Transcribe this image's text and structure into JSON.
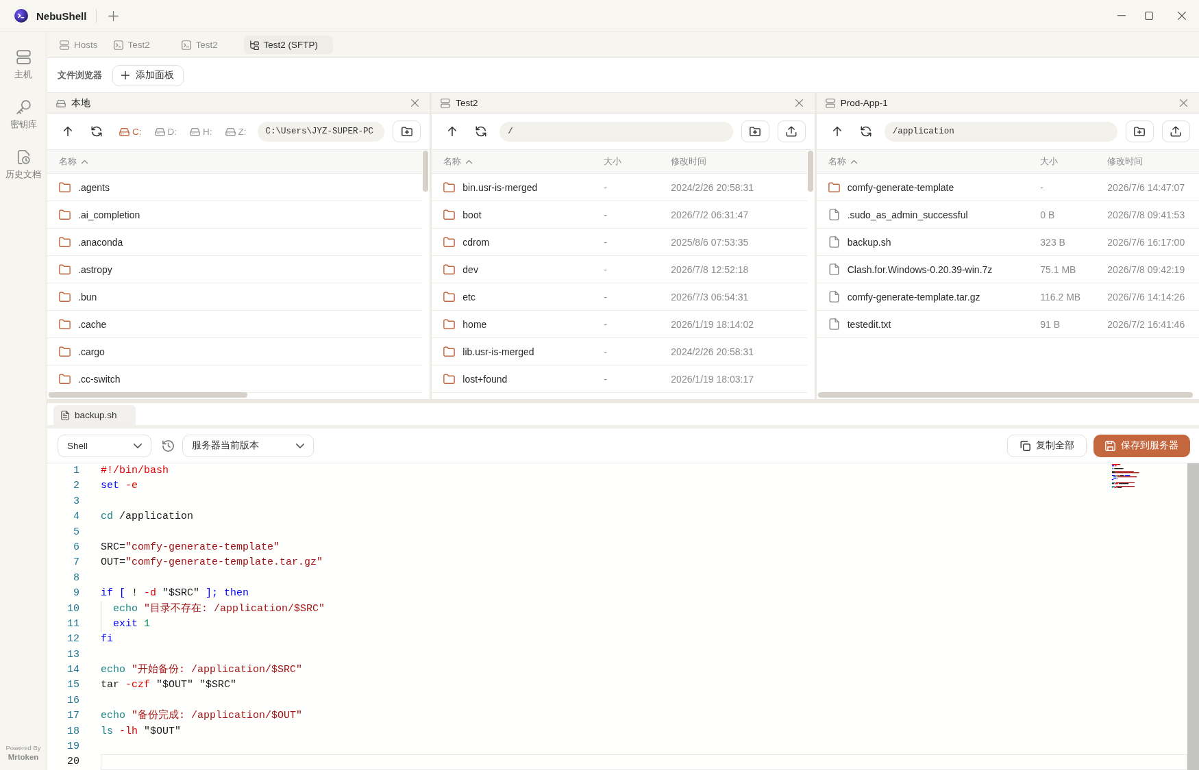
{
  "window": {
    "app_name": "NebuShell"
  },
  "sidebar": {
    "items": [
      {
        "label": "主机",
        "kind": "hosts"
      },
      {
        "label": "密钥库",
        "kind": "keys"
      },
      {
        "label": "历史文档",
        "kind": "history"
      }
    ],
    "footer": {
      "caption": "Powered By",
      "brand": "Mrtoken"
    }
  },
  "tabs": [
    {
      "label": "Hosts",
      "kind": "hosts",
      "selected": false
    },
    {
      "label": "Test2",
      "kind": "terminal",
      "selected": false
    },
    {
      "label": "Test2",
      "kind": "terminal",
      "selected": false
    },
    {
      "label": "Test2 (SFTP)",
      "kind": "sftp",
      "selected": true
    }
  ],
  "toolbar": {
    "title": "文件浏览器",
    "add_button": "添加面板"
  },
  "panels": [
    {
      "kind": "local",
      "title": "本地",
      "drives": [
        {
          "label": "C:",
          "selected": true
        },
        {
          "label": "D:",
          "selected": false
        },
        {
          "label": "H:",
          "selected": false
        },
        {
          "label": "Z:",
          "selected": false
        }
      ],
      "path": "C:\\Users\\JYZ-SUPER-PC",
      "columns": [
        {
          "kind": "name",
          "label": "名称",
          "sorted": true
        }
      ],
      "rows": [
        {
          "kind": "folder",
          "name": ".agents"
        },
        {
          "kind": "folder",
          "name": ".ai_completion"
        },
        {
          "kind": "folder",
          "name": ".anaconda"
        },
        {
          "kind": "folder",
          "name": ".astropy"
        },
        {
          "kind": "folder",
          "name": ".bun"
        },
        {
          "kind": "folder",
          "name": ".cache"
        },
        {
          "kind": "folder",
          "name": ".cargo"
        },
        {
          "kind": "folder",
          "name": ".cc-switch"
        }
      ],
      "scroll_x": true,
      "scroll_y": true
    },
    {
      "kind": "remote",
      "title": "Test2",
      "path": "/",
      "columns": [
        {
          "kind": "name",
          "label": "名称",
          "sorted": true
        },
        {
          "kind": "size",
          "label": "大小",
          "sorted": false
        },
        {
          "kind": "modified",
          "label": "修改时间",
          "sorted": false
        }
      ],
      "rows": [
        {
          "kind": "folder",
          "name": "bin.usr-is-merged",
          "size": "-",
          "modified": "2024/2/26 20:58:31"
        },
        {
          "kind": "folder",
          "name": "boot",
          "size": "-",
          "modified": "2026/7/2 06:31:47"
        },
        {
          "kind": "folder",
          "name": "cdrom",
          "size": "-",
          "modified": "2025/8/6 07:53:35"
        },
        {
          "kind": "folder",
          "name": "dev",
          "size": "-",
          "modified": "2026/7/8 12:52:18"
        },
        {
          "kind": "folder",
          "name": "etc",
          "size": "-",
          "modified": "2026/7/3 06:54:31"
        },
        {
          "kind": "folder",
          "name": "home",
          "size": "-",
          "modified": "2026/1/19 18:14:02"
        },
        {
          "kind": "folder",
          "name": "lib.usr-is-merged",
          "size": "-",
          "modified": "2024/2/26 20:58:31"
        },
        {
          "kind": "folder",
          "name": "lost+found",
          "size": "-",
          "modified": "2026/1/19 18:03:17"
        }
      ],
      "scroll_x": false,
      "scroll_y": true
    },
    {
      "kind": "remote",
      "title": "Prod-App-1",
      "path": "/application",
      "columns": [
        {
          "kind": "name",
          "label": "名称",
          "sorted": true
        },
        {
          "kind": "size",
          "label": "大小",
          "sorted": false
        },
        {
          "kind": "modified",
          "label": "修改时间",
          "sorted": false
        }
      ],
      "rows": [
        {
          "kind": "folder",
          "name": "comfy-generate-template",
          "size": "-",
          "modified": "2026/7/6 14:47:07"
        },
        {
          "kind": "file",
          "name": ".sudo_as_admin_successful",
          "size": "0 B",
          "modified": "2026/7/8 09:41:53"
        },
        {
          "kind": "file",
          "name": "backup.sh",
          "size": "323 B",
          "modified": "2026/7/6 16:17:00"
        },
        {
          "kind": "file",
          "name": "Clash.for.Windows-0.20.39-win.7z",
          "size": "75.1 MB",
          "modified": "2026/7/8 09:42:19"
        },
        {
          "kind": "file",
          "name": "comfy-generate-template.tar.gz",
          "size": "116.2 MB",
          "modified": "2026/7/6 14:14:26"
        },
        {
          "kind": "file",
          "name": "testedit.txt",
          "size": "91 B",
          "modified": "2026/7/2 16:41:46"
        }
      ],
      "scroll_x": true,
      "scroll_y": false
    }
  ],
  "editor": {
    "tabs": [
      {
        "label": "backup.sh",
        "selected": true
      }
    ],
    "language": "Shell",
    "version": "服务器当前版本",
    "copy_button": "复制全部",
    "save_button": "保存到服务器",
    "lines": [
      {
        "number": "1",
        "active": false,
        "tokens": [
          {
            "text": "#!/bin/bash",
            "kind": "meta"
          }
        ]
      },
      {
        "number": "2",
        "active": false,
        "tokens": [
          {
            "text": "set",
            "kind": "keyword"
          },
          {
            "text": " -e",
            "kind": "flag"
          }
        ]
      },
      {
        "number": "3",
        "active": false
      },
      {
        "number": "4",
        "active": false,
        "tokens": [
          {
            "text": "cd",
            "kind": "builtin"
          },
          {
            "text": " /application",
            "kind": "plain"
          }
        ]
      },
      {
        "number": "5",
        "active": false
      },
      {
        "number": "6",
        "active": false,
        "tokens": [
          {
            "text": "SRC=",
            "kind": "plain"
          },
          {
            "text": "\"comfy-generate-template\"",
            "kind": "string"
          }
        ]
      },
      {
        "number": "7",
        "active": false,
        "tokens": [
          {
            "text": "OUT=",
            "kind": "plain"
          },
          {
            "text": "\"comfy-generate-template.tar.gz\"",
            "kind": "string"
          }
        ]
      },
      {
        "number": "8",
        "active": false
      },
      {
        "number": "9",
        "active": false,
        "tokens": [
          {
            "text": "if [",
            "kind": "keyword"
          },
          {
            "text": " ! ",
            "kind": "plain"
          },
          {
            "text": "-d",
            "kind": "flag"
          },
          {
            "text": " \"$SRC\" ",
            "kind": "plain"
          },
          {
            "text": "]; then",
            "kind": "keyword"
          }
        ],
        "children": [
          {
            "number": "10",
            "active": false,
            "tokens": [
              {
                "text": "echo",
                "kind": "builtin"
              },
              {
                "text": " \"目录不存在: /application/$SRC\"",
                "kind": "string"
              }
            ]
          },
          {
            "number": "11",
            "active": false,
            "tokens": [
              {
                "text": "exit",
                "kind": "keyword"
              },
              {
                "text": " 1",
                "kind": "number"
              }
            ]
          }
        ]
      },
      {
        "number": "12",
        "active": false,
        "tokens": [
          {
            "text": "fi",
            "kind": "keyword"
          }
        ]
      },
      {
        "number": "13",
        "active": false
      },
      {
        "number": "14",
        "active": false,
        "tokens": [
          {
            "text": "echo",
            "kind": "builtin"
          },
          {
            "text": " \"开始备份: /application/$SRC\"",
            "kind": "string"
          }
        ]
      },
      {
        "number": "15",
        "active": false,
        "tokens": [
          {
            "text": "tar",
            "kind": "plain"
          },
          {
            "text": " -czf",
            "kind": "flag"
          },
          {
            "text": " \"$OUT\" \"$SRC\"",
            "kind": "plain"
          }
        ]
      },
      {
        "number": "16",
        "active": false
      },
      {
        "number": "17",
        "active": false,
        "tokens": [
          {
            "text": "echo",
            "kind": "builtin"
          },
          {
            "text": " \"备份完成: /application/$OUT\"",
            "kind": "string"
          }
        ]
      },
      {
        "number": "18",
        "active": false,
        "tokens": [
          {
            "text": "ls",
            "kind": "builtin"
          },
          {
            "text": " -lh",
            "kind": "flag"
          },
          {
            "text": " \"$OUT\"",
            "kind": "plain"
          }
        ]
      },
      {
        "number": "19",
        "active": false
      },
      {
        "number": "20",
        "active": true
      }
    ]
  }
}
